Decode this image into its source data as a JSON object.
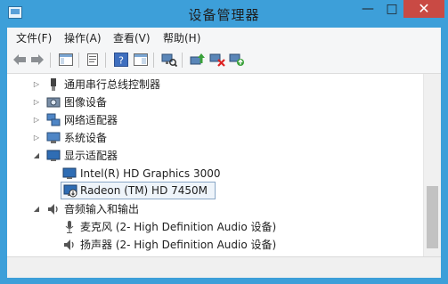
{
  "window": {
    "title": "设备管理器"
  },
  "controls": {
    "minimize": "—",
    "maximize": "□",
    "close": "✕"
  },
  "menu": {
    "items": [
      "文件(F)",
      "操作(A)",
      "查看(V)",
      "帮助(H)"
    ]
  },
  "tree": {
    "rows": [
      {
        "label": "通用串行总线控制器",
        "icon": "usb-controller-icon",
        "expanded": false
      },
      {
        "label": "图像设备",
        "icon": "camera-icon",
        "expanded": false
      },
      {
        "label": "网络适配器",
        "icon": "network-adapter-icon",
        "expanded": false
      },
      {
        "label": "系统设备",
        "icon": "system-device-icon",
        "expanded": false
      },
      {
        "label": "显示适配器",
        "icon": "display-adapter-icon",
        "expanded": true
      },
      {
        "label": "Intel(R) HD Graphics 3000",
        "icon": "monitor-icon",
        "child": true
      },
      {
        "label": "Radeon (TM) HD 7450M",
        "icon": "monitor-disabled-icon",
        "child": true,
        "selected": true
      },
      {
        "label": "音频输入和输出",
        "icon": "speaker-icon",
        "expanded": true
      },
      {
        "label": "麦克风 (2- High Definition Audio 设备)",
        "icon": "microphone-icon",
        "child": true
      },
      {
        "label": "扬声器 (2- High Definition Audio 设备)",
        "icon": "speaker-device-icon",
        "child": true
      }
    ]
  },
  "colors": {
    "titlebar": "#3d9fd9",
    "close": "#c94a44",
    "selection_border": "#8aa7c6"
  }
}
